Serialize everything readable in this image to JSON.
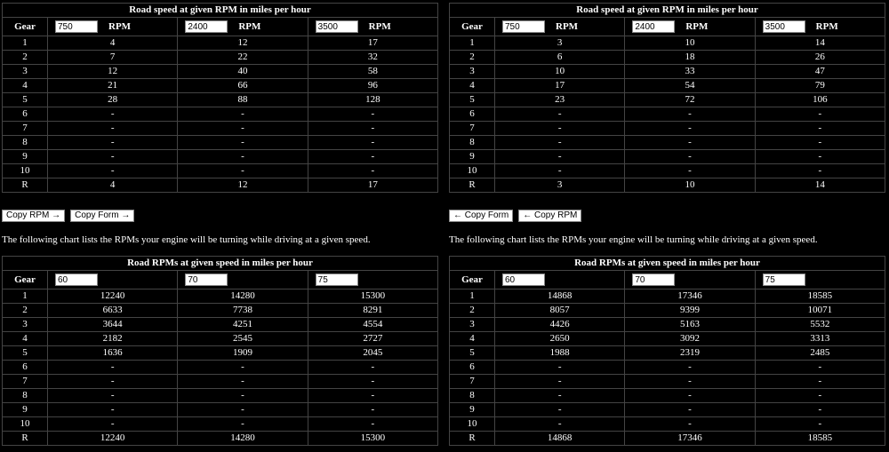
{
  "labels": {
    "gear": "Gear",
    "rpm_unit": "RPM",
    "speed_title": "Road speed at given RPM in miles per hour",
    "rpm_title": "Road RPMs at given speed in miles per hour",
    "note": "The following chart lists the RPMs your engine will be turning while driving at a given speed."
  },
  "left": {
    "top_inputs": [
      "750",
      "2400",
      "3500"
    ],
    "top_rows": [
      {
        "gear": "1",
        "v": [
          "4",
          "12",
          "17"
        ]
      },
      {
        "gear": "2",
        "v": [
          "7",
          "22",
          "32"
        ]
      },
      {
        "gear": "3",
        "v": [
          "12",
          "40",
          "58"
        ]
      },
      {
        "gear": "4",
        "v": [
          "21",
          "66",
          "96"
        ]
      },
      {
        "gear": "5",
        "v": [
          "28",
          "88",
          "128"
        ]
      },
      {
        "gear": "6",
        "v": [
          "-",
          "-",
          "-"
        ]
      },
      {
        "gear": "7",
        "v": [
          "-",
          "-",
          "-"
        ]
      },
      {
        "gear": "8",
        "v": [
          "-",
          "-",
          "-"
        ]
      },
      {
        "gear": "9",
        "v": [
          "-",
          "-",
          "-"
        ]
      },
      {
        "gear": "10",
        "v": [
          "-",
          "-",
          "-"
        ]
      },
      {
        "gear": "R",
        "v": [
          "4",
          "12",
          "17"
        ]
      }
    ],
    "buttons": [
      "Copy RPM →",
      "Copy Form →"
    ],
    "bottom_inputs": [
      "60",
      "70",
      "75"
    ],
    "bottom_rows": [
      {
        "gear": "1",
        "v": [
          "12240",
          "14280",
          "15300"
        ]
      },
      {
        "gear": "2",
        "v": [
          "6633",
          "7738",
          "8291"
        ]
      },
      {
        "gear": "3",
        "v": [
          "3644",
          "4251",
          "4554"
        ]
      },
      {
        "gear": "4",
        "v": [
          "2182",
          "2545",
          "2727"
        ]
      },
      {
        "gear": "5",
        "v": [
          "1636",
          "1909",
          "2045"
        ]
      },
      {
        "gear": "6",
        "v": [
          "-",
          "-",
          "-"
        ]
      },
      {
        "gear": "7",
        "v": [
          "-",
          "-",
          "-"
        ]
      },
      {
        "gear": "8",
        "v": [
          "-",
          "-",
          "-"
        ]
      },
      {
        "gear": "9",
        "v": [
          "-",
          "-",
          "-"
        ]
      },
      {
        "gear": "10",
        "v": [
          "-",
          "-",
          "-"
        ]
      },
      {
        "gear": "R",
        "v": [
          "12240",
          "14280",
          "15300"
        ]
      }
    ]
  },
  "right": {
    "top_inputs": [
      "750",
      "2400",
      "3500"
    ],
    "top_rows": [
      {
        "gear": "1",
        "v": [
          "3",
          "10",
          "14"
        ]
      },
      {
        "gear": "2",
        "v": [
          "6",
          "18",
          "26"
        ]
      },
      {
        "gear": "3",
        "v": [
          "10",
          "33",
          "47"
        ]
      },
      {
        "gear": "4",
        "v": [
          "17",
          "54",
          "79"
        ]
      },
      {
        "gear": "5",
        "v": [
          "23",
          "72",
          "106"
        ]
      },
      {
        "gear": "6",
        "v": [
          "-",
          "-",
          "-"
        ]
      },
      {
        "gear": "7",
        "v": [
          "-",
          "-",
          "-"
        ]
      },
      {
        "gear": "8",
        "v": [
          "-",
          "-",
          "-"
        ]
      },
      {
        "gear": "9",
        "v": [
          "-",
          "-",
          "-"
        ]
      },
      {
        "gear": "10",
        "v": [
          "-",
          "-",
          "-"
        ]
      },
      {
        "gear": "R",
        "v": [
          "3",
          "10",
          "14"
        ]
      }
    ],
    "buttons": [
      "← Copy Form",
      "← Copy RPM"
    ],
    "bottom_inputs": [
      "60",
      "70",
      "75"
    ],
    "bottom_rows": [
      {
        "gear": "1",
        "v": [
          "14868",
          "17346",
          "18585"
        ]
      },
      {
        "gear": "2",
        "v": [
          "8057",
          "9399",
          "10071"
        ]
      },
      {
        "gear": "3",
        "v": [
          "4426",
          "5163",
          "5532"
        ]
      },
      {
        "gear": "4",
        "v": [
          "2650",
          "3092",
          "3313"
        ]
      },
      {
        "gear": "5",
        "v": [
          "1988",
          "2319",
          "2485"
        ]
      },
      {
        "gear": "6",
        "v": [
          "-",
          "-",
          "-"
        ]
      },
      {
        "gear": "7",
        "v": [
          "-",
          "-",
          "-"
        ]
      },
      {
        "gear": "8",
        "v": [
          "-",
          "-",
          "-"
        ]
      },
      {
        "gear": "9",
        "v": [
          "-",
          "-",
          "-"
        ]
      },
      {
        "gear": "10",
        "v": [
          "-",
          "-",
          "-"
        ]
      },
      {
        "gear": "R",
        "v": [
          "14868",
          "17346",
          "18585"
        ]
      }
    ]
  }
}
